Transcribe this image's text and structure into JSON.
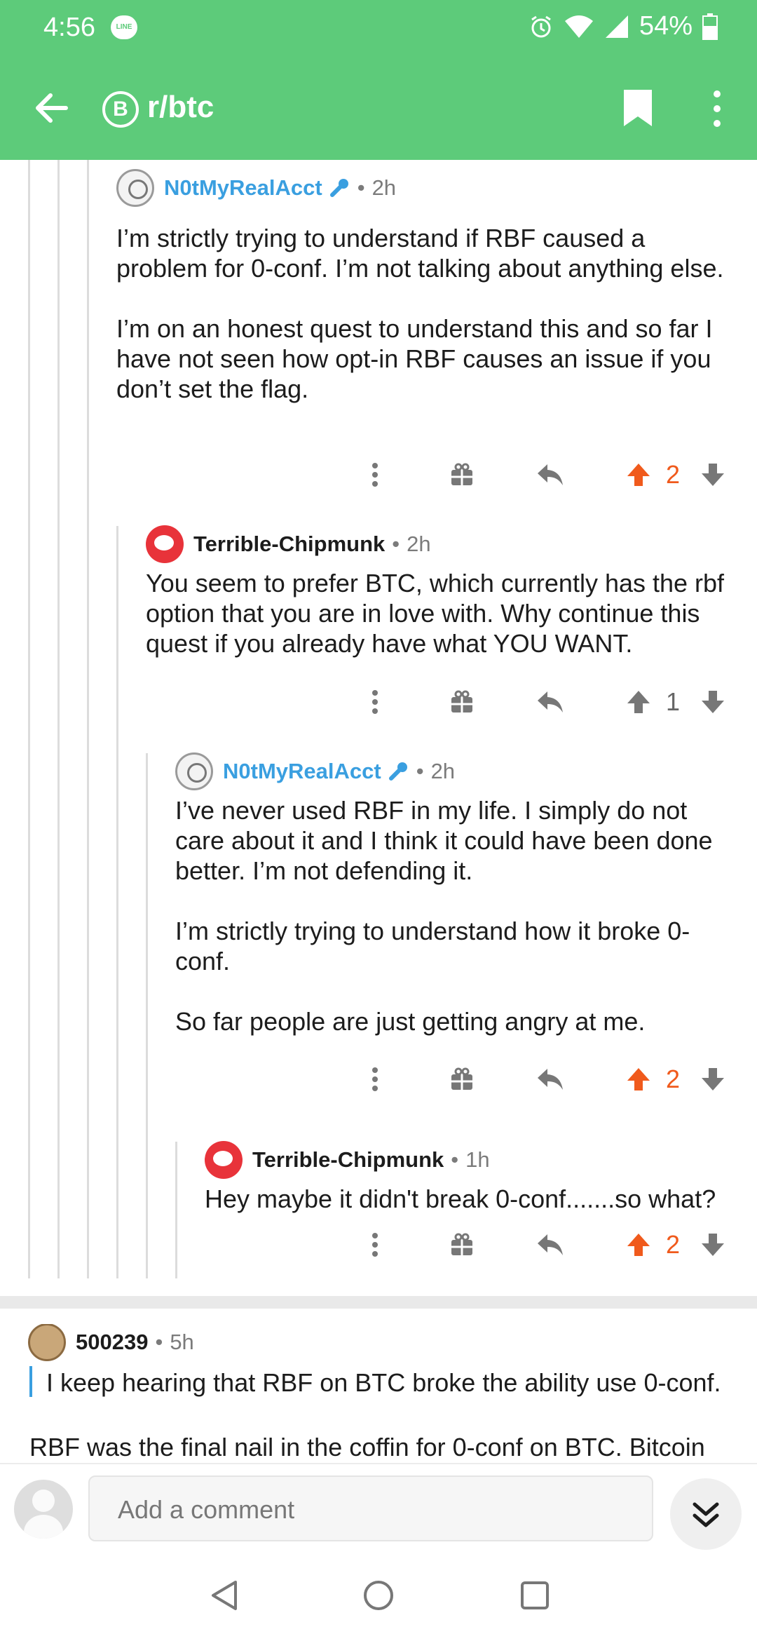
{
  "status_bar": {
    "time": "4:56",
    "line_badge": "LINE",
    "battery": "54%"
  },
  "app_bar": {
    "subreddit": "r/btc",
    "sub_icon": "B"
  },
  "comments": [
    {
      "author": "N0tMyRealAcct",
      "age": "2h",
      "paragraphs": [
        "I’m strictly trying to understand if RBF caused a problem for 0-conf. I’m not talking about anything else.",
        "I’m on an honest quest to understand this and so far I have not seen how opt-in RBF causes an issue if you don’t set the flag."
      ],
      "score": "2"
    },
    {
      "author": "Terrible-Chipmunk",
      "age": "2h",
      "paragraphs": [
        "You seem to prefer BTC, which currently has the rbf option that you are in love with.  Why continue this quest if you already have what YOU WANT."
      ],
      "score": "1"
    },
    {
      "author": "N0tMyRealAcct",
      "age": "2h",
      "paragraphs": [
        "I’ve never used RBF in my life. I simply do not care about it and I think it could have been done better. I’m not defending it.",
        "I’m strictly trying to understand how it broke 0-conf.",
        "So far people are just getting angry at me."
      ],
      "score": "2"
    },
    {
      "author": "Terrible-Chipmunk",
      "age": "1h",
      "paragraphs": [
        "Hey maybe it didn't break 0-conf.......so what?"
      ],
      "score": "2"
    }
  ],
  "top_comment": {
    "author": "500239",
    "age": "5h",
    "quote": "I keep hearing that RBF on BTC broke the ability use 0-conf.",
    "text": "RBF was the final nail in the coffin for 0-conf on BTC. Bitcoin"
  },
  "composer": {
    "placeholder": "Add a comment"
  },
  "meta_dot": "•",
  "colors": {
    "brand_green": "#5dcb7a",
    "upvote": "#f05a1c",
    "mod_blue": "#3a9fe0"
  }
}
